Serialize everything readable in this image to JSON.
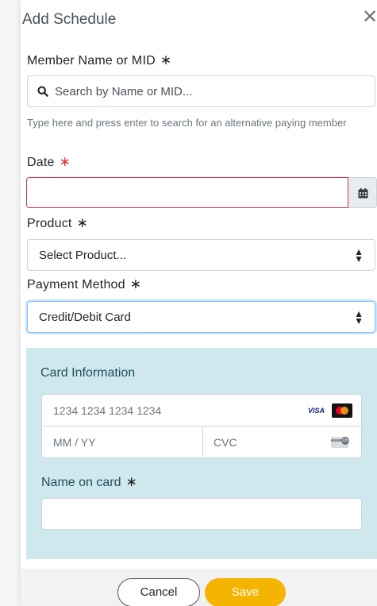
{
  "header": {
    "title": "Add Schedule",
    "close_glyph": "✕"
  },
  "member": {
    "label": "Member Name or MID",
    "required_mark": "∗",
    "search_placeholder": "Search by Name or MID...",
    "search_icon": "search-icon",
    "help_text": "Type here and press enter to search for an alternative paying member"
  },
  "date": {
    "label": "Date",
    "required_mark": "∗",
    "value": "",
    "icon": "calendar-icon",
    "error_color": "#dc3545"
  },
  "product": {
    "label": "Product",
    "required_mark": "∗",
    "selected": "Select Product...",
    "arrow_glyph": "⬍"
  },
  "payment": {
    "label": "Payment Method",
    "required_mark": "∗",
    "selected": "Credit/Debit Card",
    "arrow_glyph": "⬍"
  },
  "card": {
    "title": "Card Information",
    "number_placeholder": "1234 1234 1234 1234",
    "expiry_placeholder": "MM / YY",
    "cvc_placeholder": "CVC",
    "brand_visa": "VISA",
    "cvc_badge": "135",
    "name_label": "Name on card",
    "name_required_mark": "∗",
    "name_value": "",
    "panel_color": "#cfe8ee"
  },
  "footer": {
    "cancel_label": "Cancel",
    "save_label": "Save",
    "save_color": "#f5b400"
  }
}
